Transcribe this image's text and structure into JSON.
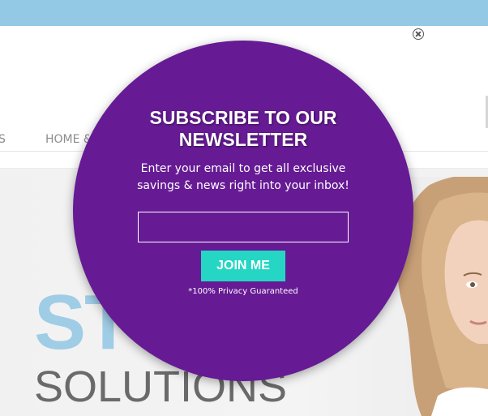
{
  "nav": {
    "items": [
      "S",
      "HOME &"
    ]
  },
  "hero": {
    "headline": "ST",
    "subheadline": "SOLUTIONS"
  },
  "popup": {
    "title_line1": "SUBSCRIBE TO OUR",
    "title_line2": "NEWSLETTER",
    "description": "Enter your email to get all exclusive savings & news right into your inbox!",
    "email_placeholder": "",
    "button_label": "JOIN ME",
    "privacy_note": "*100% Privacy Guaranteed"
  },
  "colors": {
    "popup_bg": "#661a94",
    "accent": "#25d6c4",
    "topbar": "#93c9e4",
    "hero_headline": "#9fcde6"
  },
  "icons": {
    "close": "close-circle-icon"
  }
}
